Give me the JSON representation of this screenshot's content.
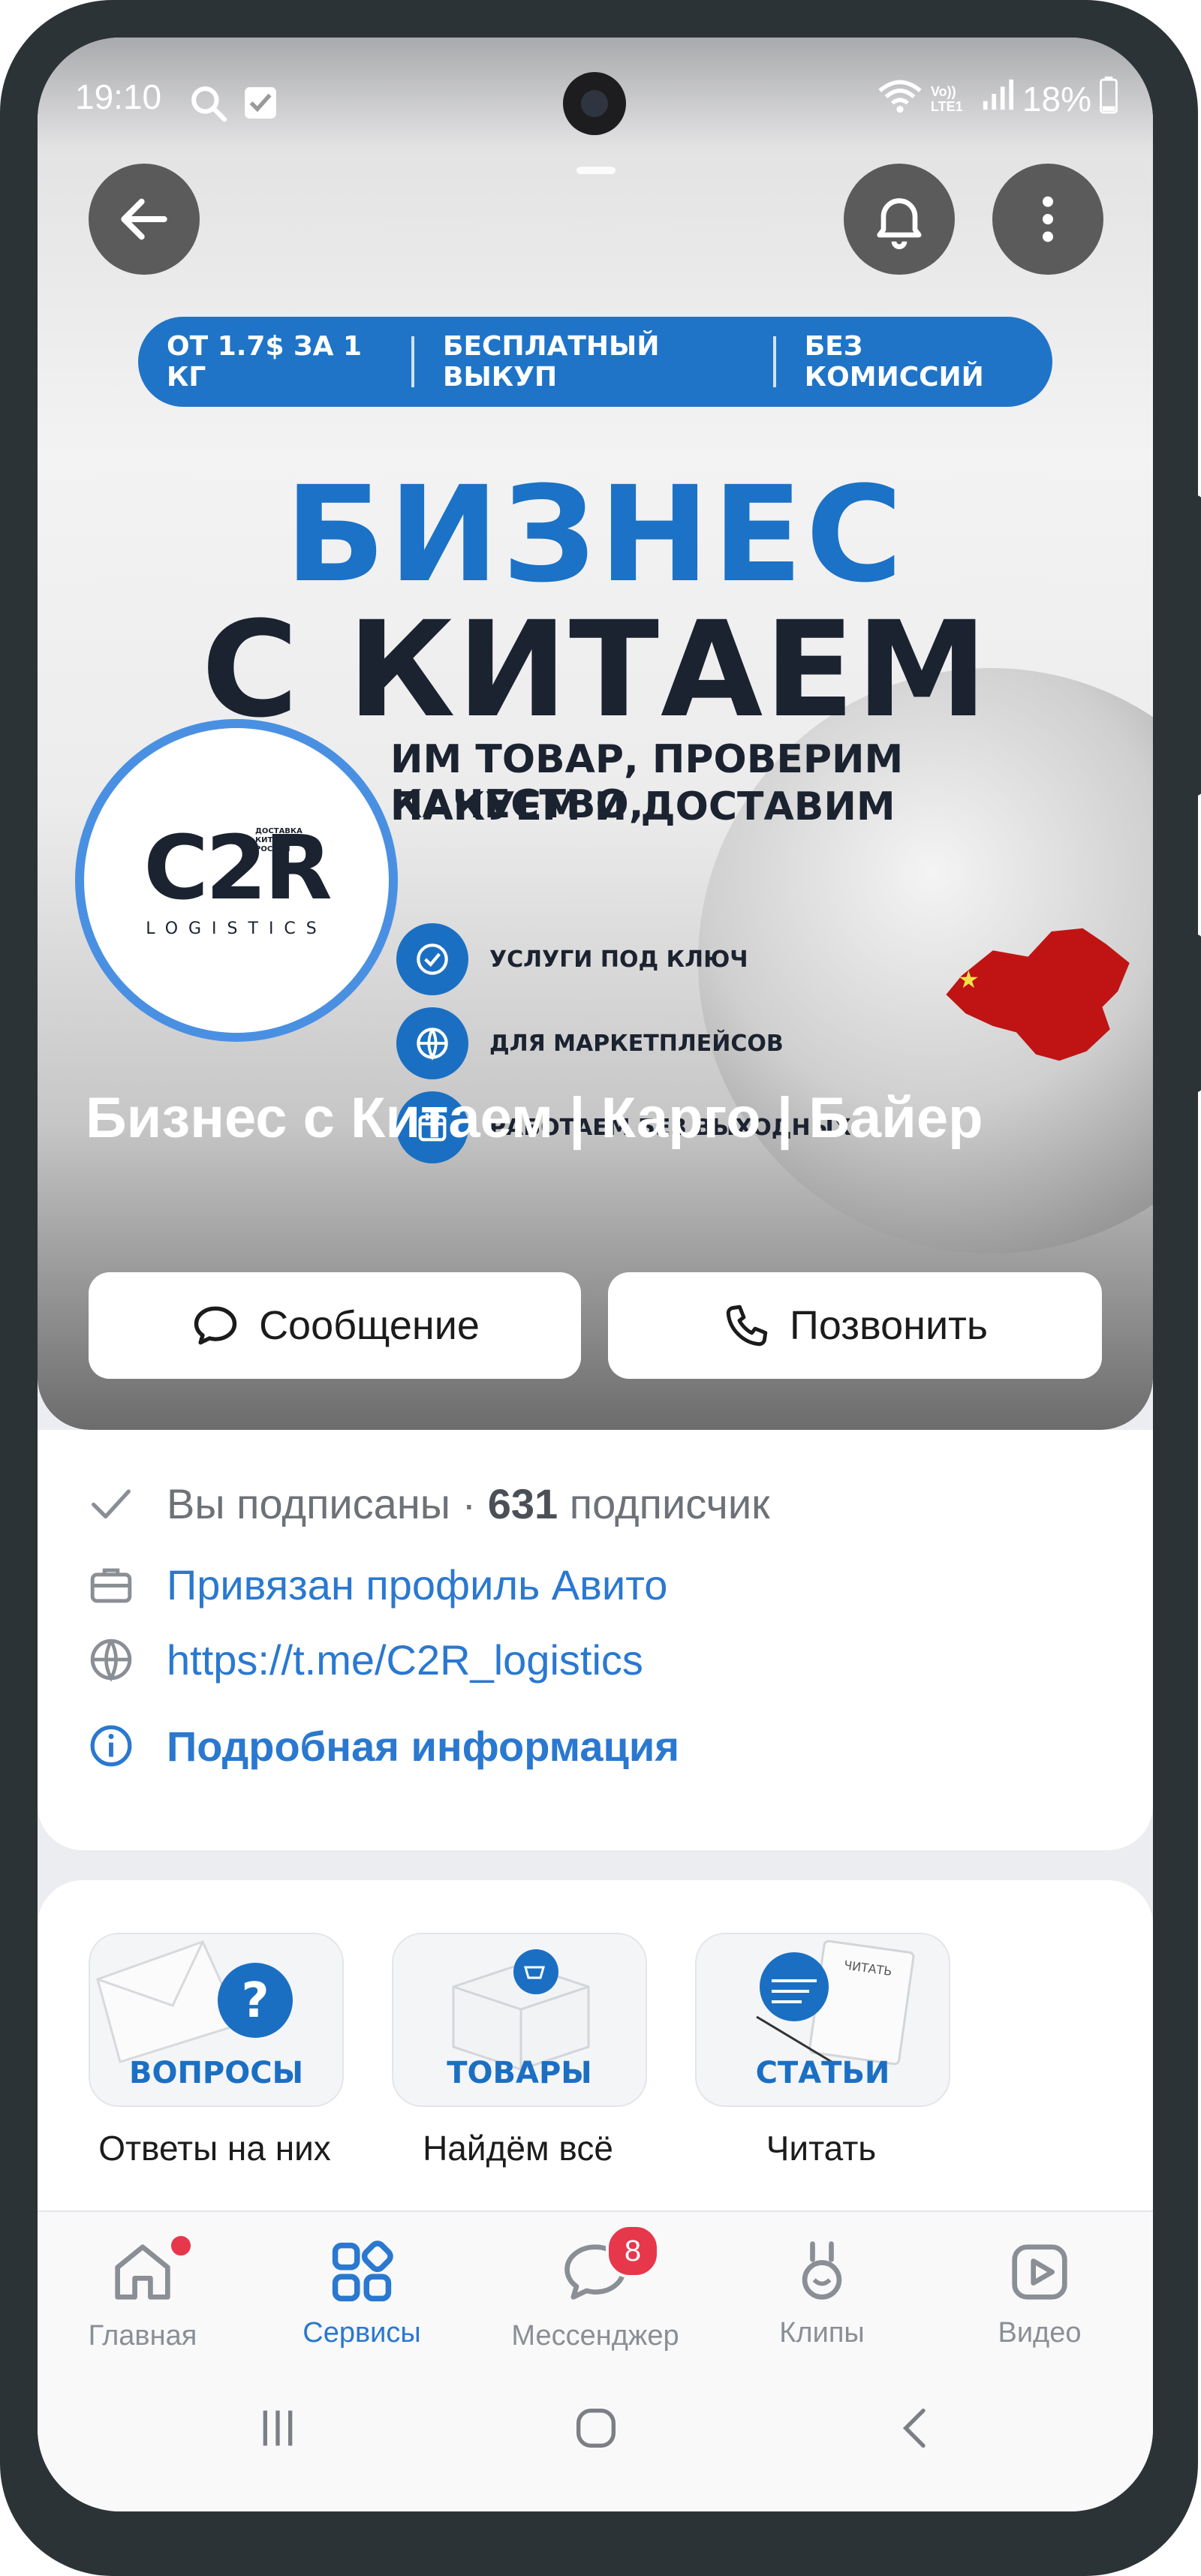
{
  "status_bar": {
    "time": "19:10",
    "volte": "Vo)) LTE1",
    "battery": "18%"
  },
  "banner": {
    "pill": [
      "ОТ 1.7$ ЗА 1 КГ",
      "БЕСПЛАТНЫЙ ВЫКУП",
      "БЕЗ КОМИССИЙ"
    ],
    "headline_line1": "БИЗНЕС",
    "headline_line2": "С КИТАЕМ",
    "sub_line1": "ИМ ТОВАР, ПРОВЕРИМ КАЧЕСТВО,",
    "sub_line2": "ПАКУЕМ И ДОСТАВИМ",
    "features": [
      "УСЛУГИ ПОД КЛЮЧ",
      "ДЛЯ МАРКЕТПЛЕЙСОВ",
      "РАБОТАЕМ БЕЗ ВЫХОДНЫХ"
    ]
  },
  "logo": {
    "main": "C2R",
    "sub": "LOGISTICS",
    "tiny": "ДОСТАВКА КИТАЙ - РОССИЯ"
  },
  "community": {
    "name": "Бизнес с Китаем | Карго | Байер"
  },
  "actions": {
    "message": "Сообщение",
    "call": "Позвонить"
  },
  "info": {
    "subscribed": "Вы подписаны · ",
    "subscribers_count": "631",
    "subscribers_label": " подписчик",
    "avito": "Привязан профиль Авито",
    "link": "https://t.me/C2R_logistics",
    "details": "Подробная информация"
  },
  "services": [
    {
      "label": "ВОПРОСЫ",
      "caption": "Ответы на них"
    },
    {
      "label": "ТОВАРЫ",
      "caption": "Найдём всё"
    },
    {
      "label": "СТАТЬИ",
      "caption": "Читать"
    }
  ],
  "tabs": [
    {
      "label": "Главная",
      "icon": "home-icon"
    },
    {
      "label": "Сервисы",
      "icon": "services-icon"
    },
    {
      "label": "Мессенджер",
      "icon": "messenger-icon",
      "badge": "8"
    },
    {
      "label": "Клипы",
      "icon": "clips-icon"
    },
    {
      "label": "Видео",
      "icon": "video-icon"
    }
  ],
  "colors": {
    "accent": "#2a78d0",
    "badge": "#e6374b",
    "banner_blue": "#1b72c6",
    "frame": "#2c3337"
  }
}
